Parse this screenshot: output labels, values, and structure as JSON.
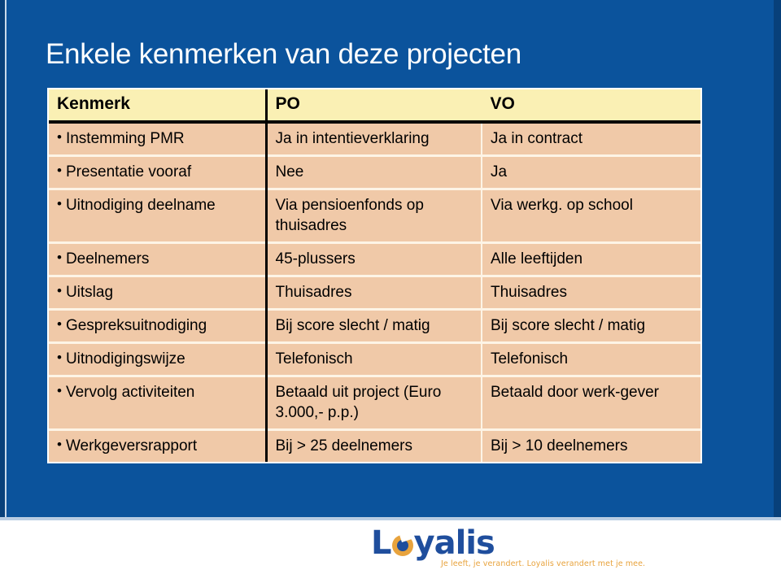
{
  "slide": {
    "title": "Enkele kenmerken van deze projecten",
    "background_color": "#0B539C",
    "title_color": "#ffffff"
  },
  "table": {
    "header_bg": "#FAF0B4",
    "body_bg": "#f0c9a8",
    "columns": [
      {
        "key": "kenmerk",
        "label": "Kenmerk"
      },
      {
        "key": "po",
        "label": "PO"
      },
      {
        "key": "vo",
        "label": "VO"
      }
    ],
    "rows": [
      {
        "kenmerk": "Instemming PMR",
        "po": "Ja in intentieverklaring",
        "vo": "Ja in contract"
      },
      {
        "kenmerk": "Presentatie vooraf",
        "po": "Nee",
        "vo": "Ja"
      },
      {
        "kenmerk": "Uitnodiging deelname",
        "po": "Via pensioenfonds op thuisadres",
        "vo": "Via werkg. op school"
      },
      {
        "kenmerk": "Deelnemers",
        "po": "45-plussers",
        "vo": "Alle leeftijden"
      },
      {
        "kenmerk": "Uitslag",
        "po": "Thuisadres",
        "vo": "Thuisadres"
      },
      {
        "kenmerk": "Gespreksuitnodiging",
        "po": "Bij score slecht / matig",
        "vo": "Bij score slecht / matig"
      },
      {
        "kenmerk": "Uitnodigingswijze",
        "po": "Telefonisch",
        "vo": "Telefonisch"
      },
      {
        "kenmerk": "Vervolg activiteiten",
        "po": "Betaald uit project (Euro 3.000,- p.p.)",
        "vo": "Betaald door werk-gever"
      },
      {
        "kenmerk": "Werkgeversrapport",
        "po": "Bij > 25 deelnemers",
        "vo": "Bij > 10 deelnemers"
      }
    ],
    "bullet_glyph": "•"
  },
  "logo": {
    "word_pre": "L",
    "word_post": "yalis",
    "tagline": "Je leeft, je verandert. Loyalis verandert met je mee.",
    "word_color": "#1F4E9D",
    "accent_color": "#E8A33D"
  }
}
